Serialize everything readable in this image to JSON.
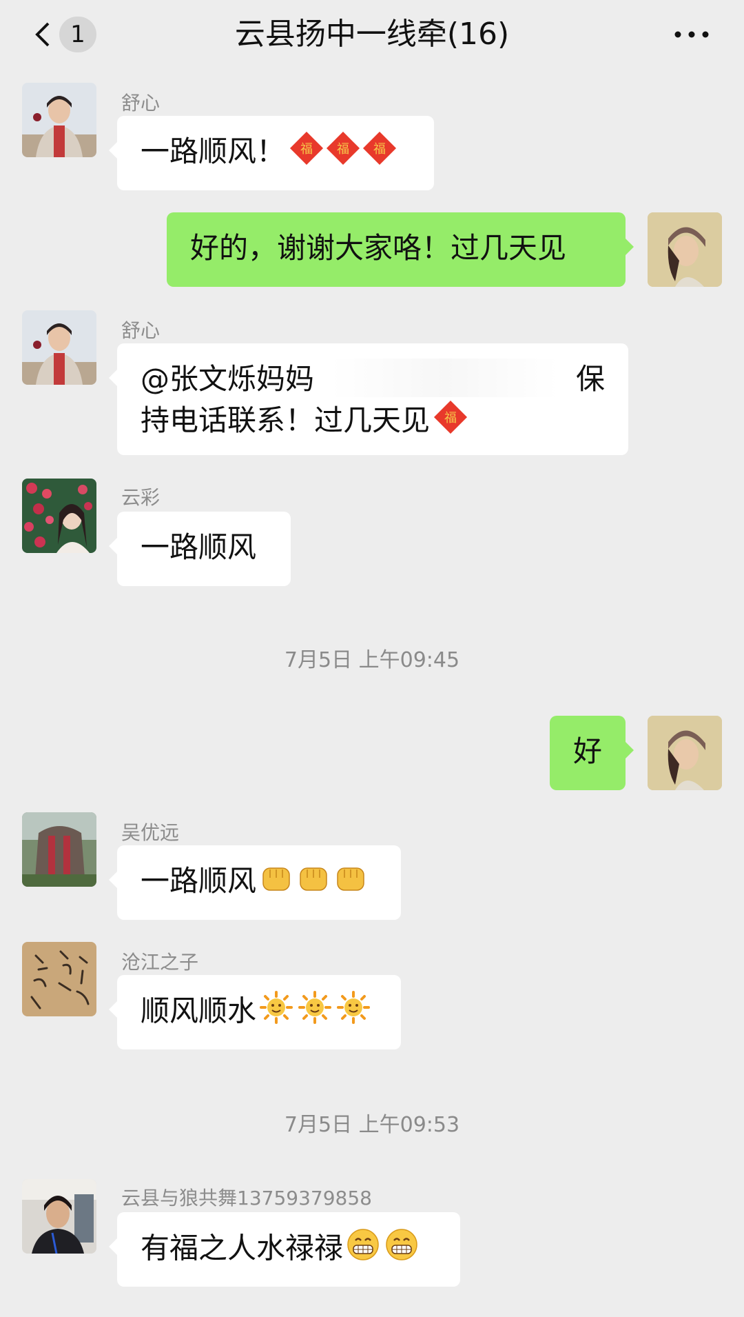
{
  "header": {
    "unread_count": "1",
    "title": "云县扬中一线牵(16)"
  },
  "messages": [
    {
      "sender": "舒心",
      "text": "一路顺风！",
      "emoji": "fu-diamond"
    },
    {
      "self": true,
      "text": "好的，谢谢大家咯！过几天见"
    },
    {
      "sender": "舒心",
      "line1_start": "@张文烁妈妈",
      "line1_end": "保",
      "line2": "持电话联系！过几天见",
      "emoji": "fu-diamond"
    },
    {
      "sender": "云彩",
      "text": "一路顺风"
    },
    {
      "timestamp": "7月5日 上午09:45"
    },
    {
      "self": true,
      "text": "好"
    },
    {
      "sender": "吴优远",
      "text": "一路顺风",
      "emoji": "raised-fist"
    },
    {
      "sender": "沧江之子",
      "text": "顺风顺水",
      "emoji": "sun-face"
    },
    {
      "timestamp": "7月5日 上午09:53"
    },
    {
      "sender": "云县与狼共舞13759379858",
      "text": "有福之人水禄禄",
      "emoji": "grin-face"
    }
  ],
  "colors": {
    "background": "#ededed",
    "self_bubble": "#95ec69",
    "other_bubble": "#ffffff"
  }
}
